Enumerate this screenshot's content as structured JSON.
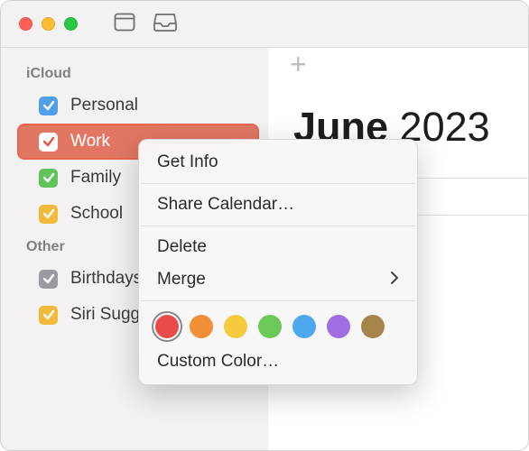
{
  "titlebar": {
    "traffic": [
      "close",
      "minimize",
      "zoom"
    ]
  },
  "sidebar": {
    "sections": [
      {
        "title": "iCloud",
        "items": [
          {
            "label": "Personal",
            "color": "#4f9fe8",
            "checked": true,
            "selected": false
          },
          {
            "label": "Work",
            "color": "#e45442",
            "checked": true,
            "selected": true
          },
          {
            "label": "Family",
            "color": "#5fc35a",
            "checked": true,
            "selected": false
          },
          {
            "label": "School",
            "color": "#f2b93b",
            "checked": true,
            "selected": false
          }
        ]
      },
      {
        "title": "Other",
        "items": [
          {
            "label": "Birthdays",
            "color": "#9a9aa0",
            "checked": true,
            "selected": false
          },
          {
            "label": "Siri Suggestions",
            "color": "#f2b93b",
            "checked": true,
            "selected": false
          }
        ]
      }
    ]
  },
  "main": {
    "month": "June",
    "year": "2023"
  },
  "context_menu": {
    "items": {
      "get_info": "Get Info",
      "share": "Share Calendar…",
      "delete": "Delete",
      "merge": "Merge",
      "custom": "Custom Color…"
    },
    "colors": [
      "#e94b4b",
      "#f2903a",
      "#f3cb3d",
      "#6cc959",
      "#4da8ee",
      "#9f6fe2",
      "#a6854a"
    ],
    "selected_color_index": 0
  }
}
